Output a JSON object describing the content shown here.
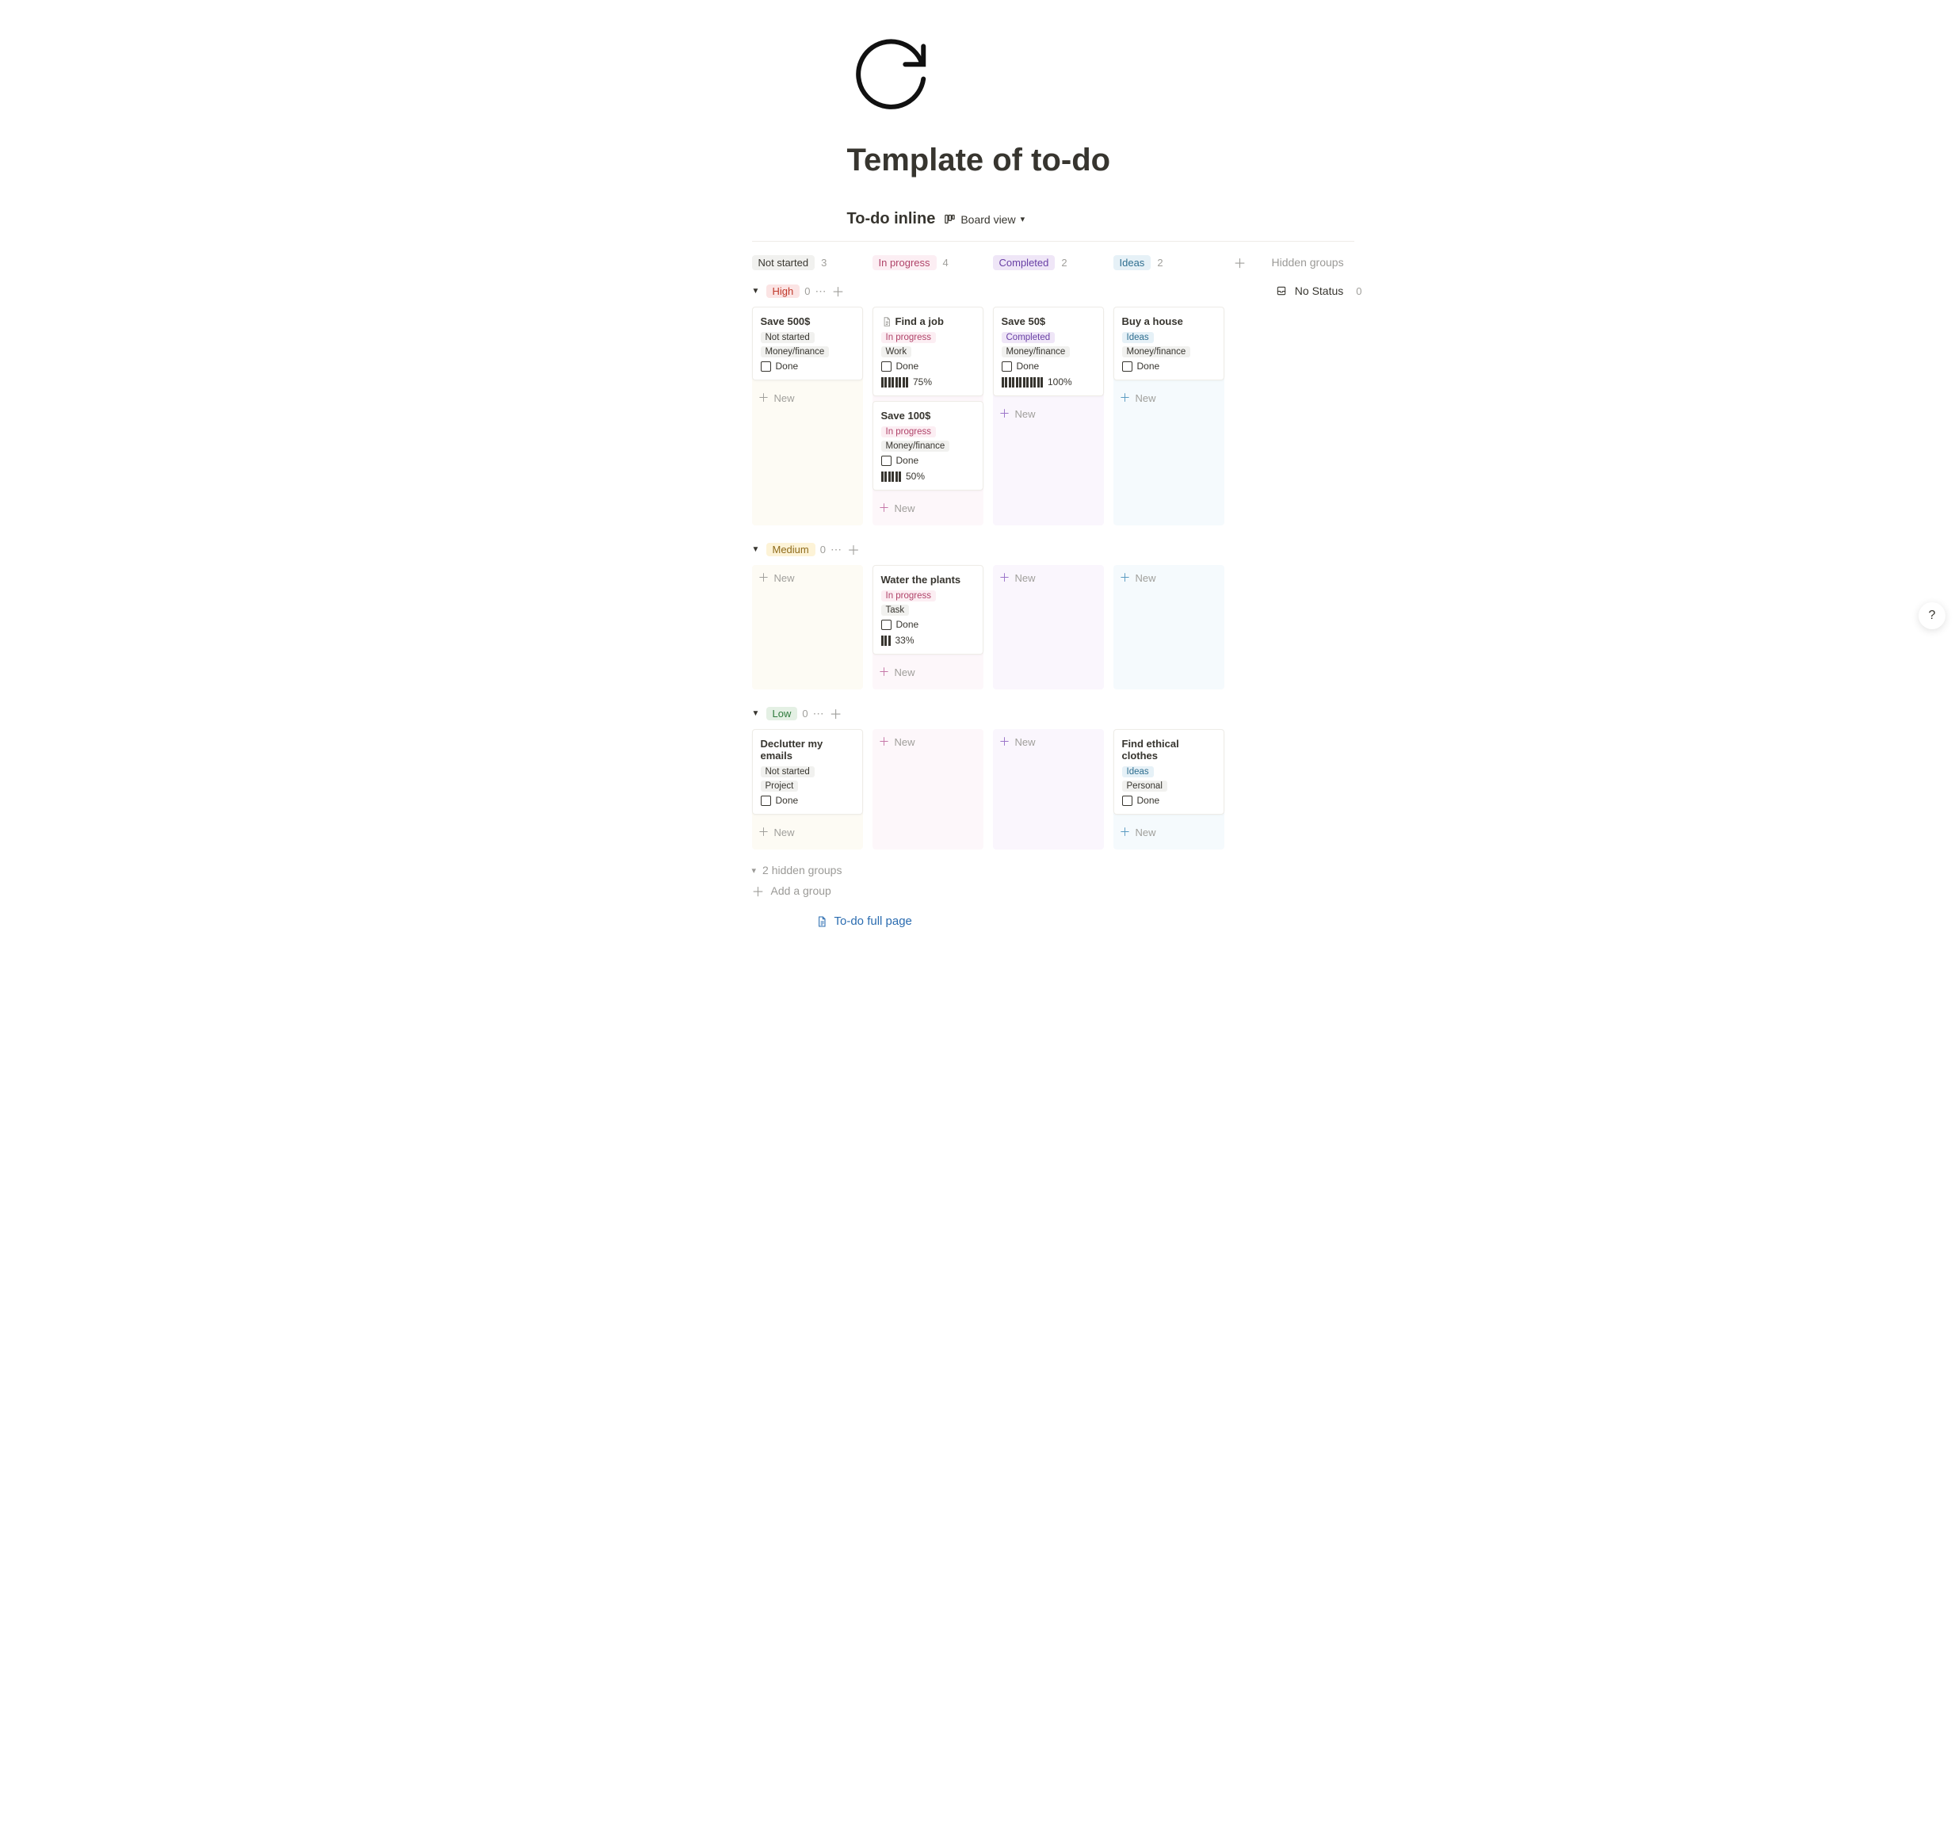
{
  "page": {
    "title": "Template of to-do"
  },
  "database": {
    "title": "To-do inline",
    "view_label": "Board view"
  },
  "columns": [
    {
      "label": "Not started",
      "count": 3,
      "color": "gray"
    },
    {
      "label": "In progress",
      "count": 4,
      "color": "pink"
    },
    {
      "label": "Completed",
      "count": 2,
      "color": "purple"
    },
    {
      "label": "Ideas",
      "count": 2,
      "color": "blue"
    }
  ],
  "hidden_groups_label": "Hidden groups",
  "no_status": {
    "label": "No Status",
    "count": 0
  },
  "tags": {
    "not_started": "Not started",
    "in_progress": "In progress",
    "completed": "Completed",
    "ideas": "Ideas",
    "money_finance": "Money/finance",
    "work": "Work",
    "task": "Task",
    "project": "Project",
    "personal": "Personal"
  },
  "labels": {
    "done": "Done",
    "new": "New",
    "hidden_groups_count": "2 hidden groups",
    "add_group": "Add a group",
    "full_page_link": "To-do full page"
  },
  "sections": [
    {
      "name": "High",
      "color": "red",
      "count": 0,
      "show_no_status": true,
      "columns": [
        {
          "bg": "yellow",
          "cards": [
            {
              "title": "Save 500$",
              "status": "not_started",
              "category": "money_finance",
              "done": false
            }
          ],
          "new_style": "gray"
        },
        {
          "bg": "pink",
          "cards": [
            {
              "title": "Find a job",
              "has_page_icon": true,
              "status": "in_progress",
              "category": "work",
              "done": false,
              "progress_pct": 75,
              "progress_bars": 8
            },
            {
              "title": "Save 100$",
              "status": "in_progress",
              "category": "money_finance",
              "done": false,
              "progress_pct": 50,
              "progress_bars": 6
            }
          ],
          "new_style": "pink"
        },
        {
          "bg": "purple",
          "cards": [
            {
              "title": "Save 50$",
              "status": "completed",
              "category": "money_finance",
              "done": false,
              "progress_pct": 100,
              "progress_bars": 12
            }
          ],
          "new_style": "purple"
        },
        {
          "bg": "blue",
          "cards": [
            {
              "title": "Buy a house",
              "status": "ideas",
              "category": "money_finance",
              "done": false
            }
          ],
          "new_style": "blue"
        }
      ]
    },
    {
      "name": "Medium",
      "color": "yellow",
      "count": 0,
      "columns": [
        {
          "bg": "yellow",
          "cards": [],
          "new_style": "gray"
        },
        {
          "bg": "pink",
          "cards": [
            {
              "title": "Water the plants",
              "status": "in_progress",
              "category": "task",
              "done": false,
              "progress_pct": 33,
              "progress_bars": 3
            }
          ],
          "new_style": "pink"
        },
        {
          "bg": "purple",
          "cards": [],
          "new_style": "purple"
        },
        {
          "bg": "blue",
          "cards": [],
          "new_style": "blue"
        }
      ]
    },
    {
      "name": "Low",
      "color": "green",
      "count": 0,
      "columns": [
        {
          "bg": "yellow",
          "cards": [
            {
              "title": "Declutter my emails",
              "status": "not_started",
              "category": "project",
              "done": false
            }
          ],
          "new_style": "gray"
        },
        {
          "bg": "pink",
          "cards": [],
          "new_style": "pink"
        },
        {
          "bg": "purple",
          "cards": [],
          "new_style": "purple"
        },
        {
          "bg": "blue",
          "cards": [
            {
              "title": "Find ethical clothes",
              "status": "ideas",
              "category": "personal",
              "done": false
            }
          ],
          "new_style": "blue"
        }
      ]
    }
  ]
}
